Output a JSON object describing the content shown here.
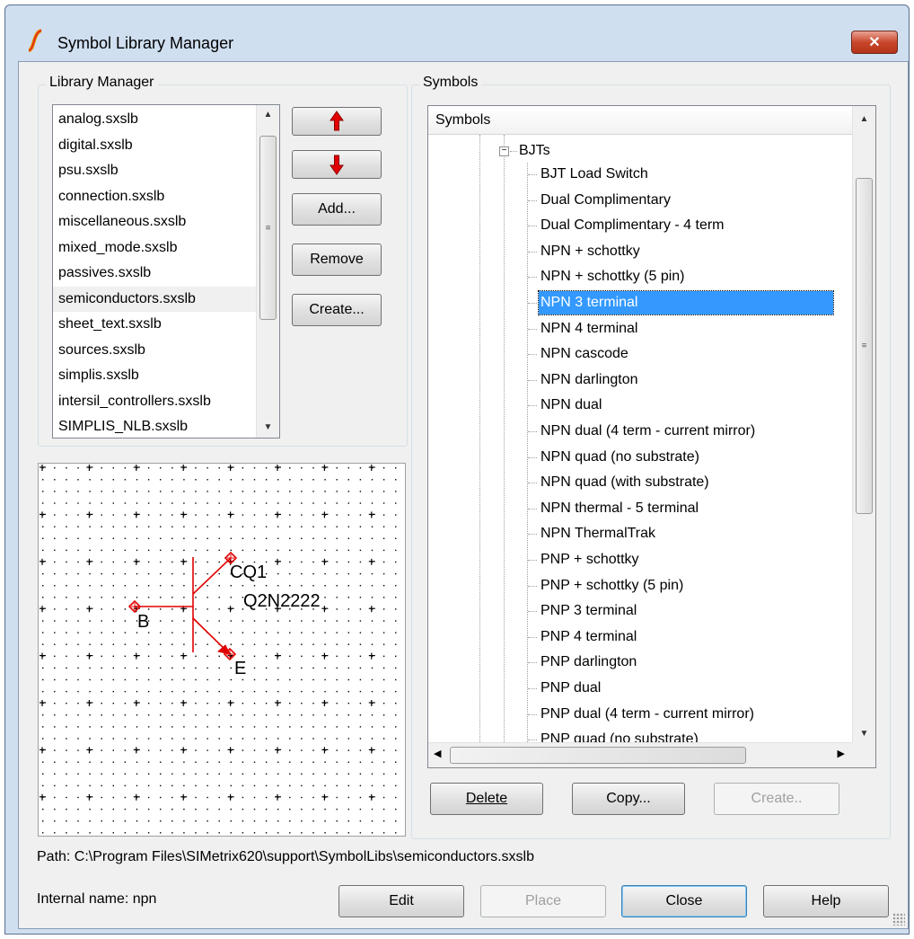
{
  "window": {
    "title": "Symbol Library Manager",
    "close_label": "✕"
  },
  "library_manager": {
    "group_title": "Library Manager",
    "items": [
      "analog.sxslb",
      "digital.sxslb",
      "psu.sxslb",
      "connection.sxslb",
      "miscellaneous.sxslb",
      "mixed_mode.sxslb",
      "passives.sxslb",
      "semiconductors.sxslb",
      "sheet_text.sxslb",
      "sources.sxslb",
      "simplis.sxslb",
      "intersil_controllers.sxslb",
      "SIMPLIS_NLB.sxslb"
    ],
    "selected_item": "semiconductors.sxslb",
    "buttons": {
      "move_up_icon": "red-up-arrow-icon",
      "move_down_icon": "red-down-arrow-icon",
      "add": "Add...",
      "remove": "Remove",
      "create": "Create..."
    }
  },
  "preview": {
    "labels": {
      "ref_prefix": "CQ1",
      "model": "Q2N2222",
      "pin_b": "B",
      "pin_e": "E"
    },
    "symbol_color": "#e00000"
  },
  "symbols": {
    "group_title": "Symbols",
    "column_header": "Symbols",
    "folder": "BJTs",
    "items": [
      "BJT Load Switch",
      "Dual Complimentary",
      "Dual Complimentary - 4 term",
      "NPN + schottky",
      "NPN + schottky (5 pin)",
      "NPN 3 terminal",
      "NPN 4 terminal",
      "NPN cascode",
      "NPN darlington",
      "NPN dual",
      "NPN dual (4 term - current mirror)",
      "NPN quad (no substrate)",
      "NPN quad (with substrate)",
      "NPN thermal - 5 terminal",
      "NPN ThermalTrak",
      "PNP + schottky",
      "PNP + schottky (5 pin)",
      "PNP 3 terminal",
      "PNP 4 terminal",
      "PNP darlington",
      "PNP dual",
      "PNP dual (4 term - current mirror)",
      "PNP quad (no substrate)"
    ],
    "selected_item": "NPN 3 terminal",
    "buttons": {
      "delete": "Delete",
      "copy": "Copy...",
      "create": "Create.."
    },
    "selection_color": "#3399ff"
  },
  "footer": {
    "path": "Path: C:\\Program Files\\SIMetrix620\\support\\SymbolLibs\\semiconductors.sxslb",
    "internal_name": "Internal name: npn",
    "buttons": {
      "edit": "Edit",
      "place": "Place",
      "close": "Close",
      "help": "Help"
    }
  }
}
